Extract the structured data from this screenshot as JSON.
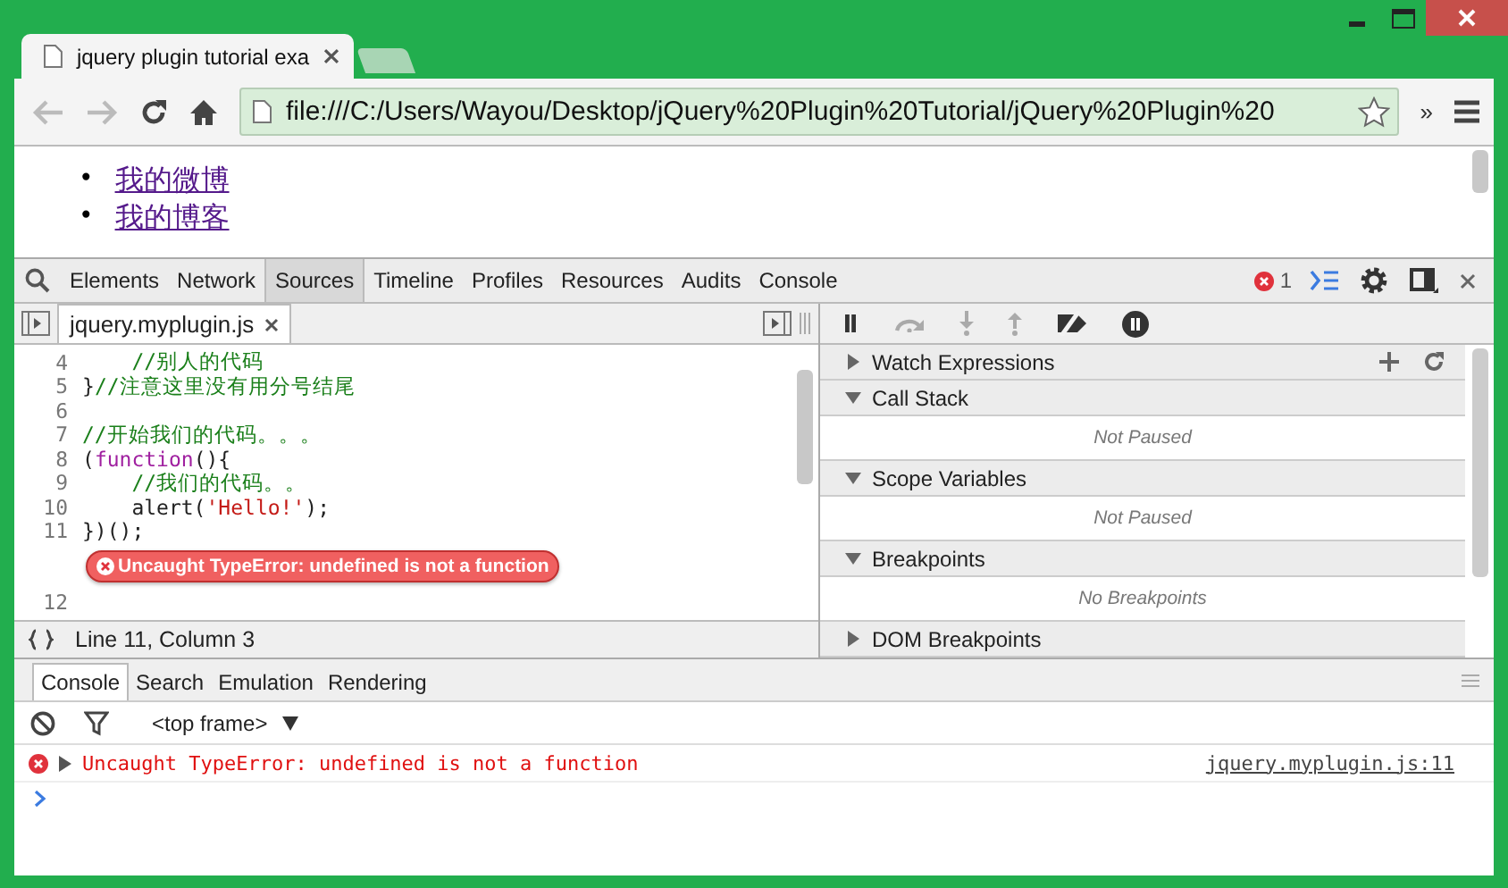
{
  "browser_tabs": [
    {
      "title": "jquery plugin tutorial exa",
      "selected": true
    },
    {
      "selected": false
    }
  ],
  "address_bar": {
    "value": "file:///C:/Users/Wayou/Desktop/jQuery%20Plugin%20Tutorial/jQuery%20Plugin%20"
  },
  "overflow_chevron": "»",
  "page": {
    "links": [
      {
        "marker": "•",
        "text": "我的微博"
      },
      {
        "marker": "•",
        "text": "我的博客"
      }
    ]
  },
  "devtools": {
    "tabs": [
      {
        "label": "Elements",
        "selected": false
      },
      {
        "label": "Network",
        "selected": false
      },
      {
        "label": "Sources",
        "selected": true
      },
      {
        "label": "Timeline",
        "selected": false
      },
      {
        "label": "Profiles",
        "selected": false
      },
      {
        "label": "Resources",
        "selected": false
      },
      {
        "label": "Audits",
        "selected": false
      },
      {
        "label": "Console",
        "selected": false
      }
    ],
    "error_count": "1"
  },
  "editor": {
    "file_tab": "jquery.myplugin.js",
    "lines": [
      {
        "kind": "code",
        "number": "4",
        "tokens": [
          {
            "kind": "comment",
            "text": "    //别人的代码"
          }
        ]
      },
      {
        "kind": "code",
        "number": "5",
        "tokens": [
          {
            "kind": "plain",
            "text": "}"
          },
          {
            "kind": "comment",
            "text": "//注意这里没有用分号结尾"
          }
        ]
      },
      {
        "kind": "code",
        "number": "6"
      },
      {
        "kind": "code",
        "number": "7",
        "tokens": [
          {
            "kind": "comment",
            "text": "//开始我们的代码。。。"
          }
        ]
      },
      {
        "kind": "code",
        "number": "8",
        "tokens": [
          {
            "kind": "plain",
            "text": "("
          },
          {
            "kind": "keyword",
            "text": "function"
          },
          {
            "kind": "plain",
            "text": "(){"
          }
        ]
      },
      {
        "kind": "code",
        "number": "9",
        "tokens": [
          {
            "kind": "comment",
            "text": "    //我们的代码。。"
          }
        ]
      },
      {
        "kind": "code",
        "number": "10",
        "tokens": [
          {
            "kind": "plain",
            "text": "    alert("
          },
          {
            "kind": "string",
            "text": "'Hello!'"
          },
          {
            "kind": "plain",
            "text": ");"
          }
        ]
      },
      {
        "kind": "code",
        "number": "11",
        "tokens": [
          {
            "kind": "plain",
            "text": "})();"
          }
        ]
      },
      {
        "kind": "error",
        "text": "Uncaught TypeError: undefined is not a function"
      },
      {
        "kind": "code",
        "number": "12"
      }
    ],
    "status": "Line 11, Column 3"
  },
  "sidebar": {
    "sections": [
      {
        "title": "Watch Expressions",
        "expanded": false,
        "tools": true
      },
      {
        "title": "Call Stack",
        "expanded": true,
        "body": "Not Paused"
      },
      {
        "title": "Scope Variables",
        "expanded": true,
        "body": "Not Paused"
      },
      {
        "title": "Breakpoints",
        "expanded": true,
        "body": "No Breakpoints"
      },
      {
        "title": "DOM Breakpoints",
        "expanded": false
      }
    ]
  },
  "drawer": {
    "tabs": [
      {
        "label": "Console",
        "selected": true
      },
      {
        "label": "Search",
        "selected": false
      },
      {
        "label": "Emulation",
        "selected": false
      },
      {
        "label": "Rendering",
        "selected": false
      }
    ],
    "frame_selector": "<top frame>",
    "messages": [
      {
        "text": "Uncaught TypeError: undefined is not a function",
        "source": "jquery.myplugin.js:11"
      }
    ]
  }
}
